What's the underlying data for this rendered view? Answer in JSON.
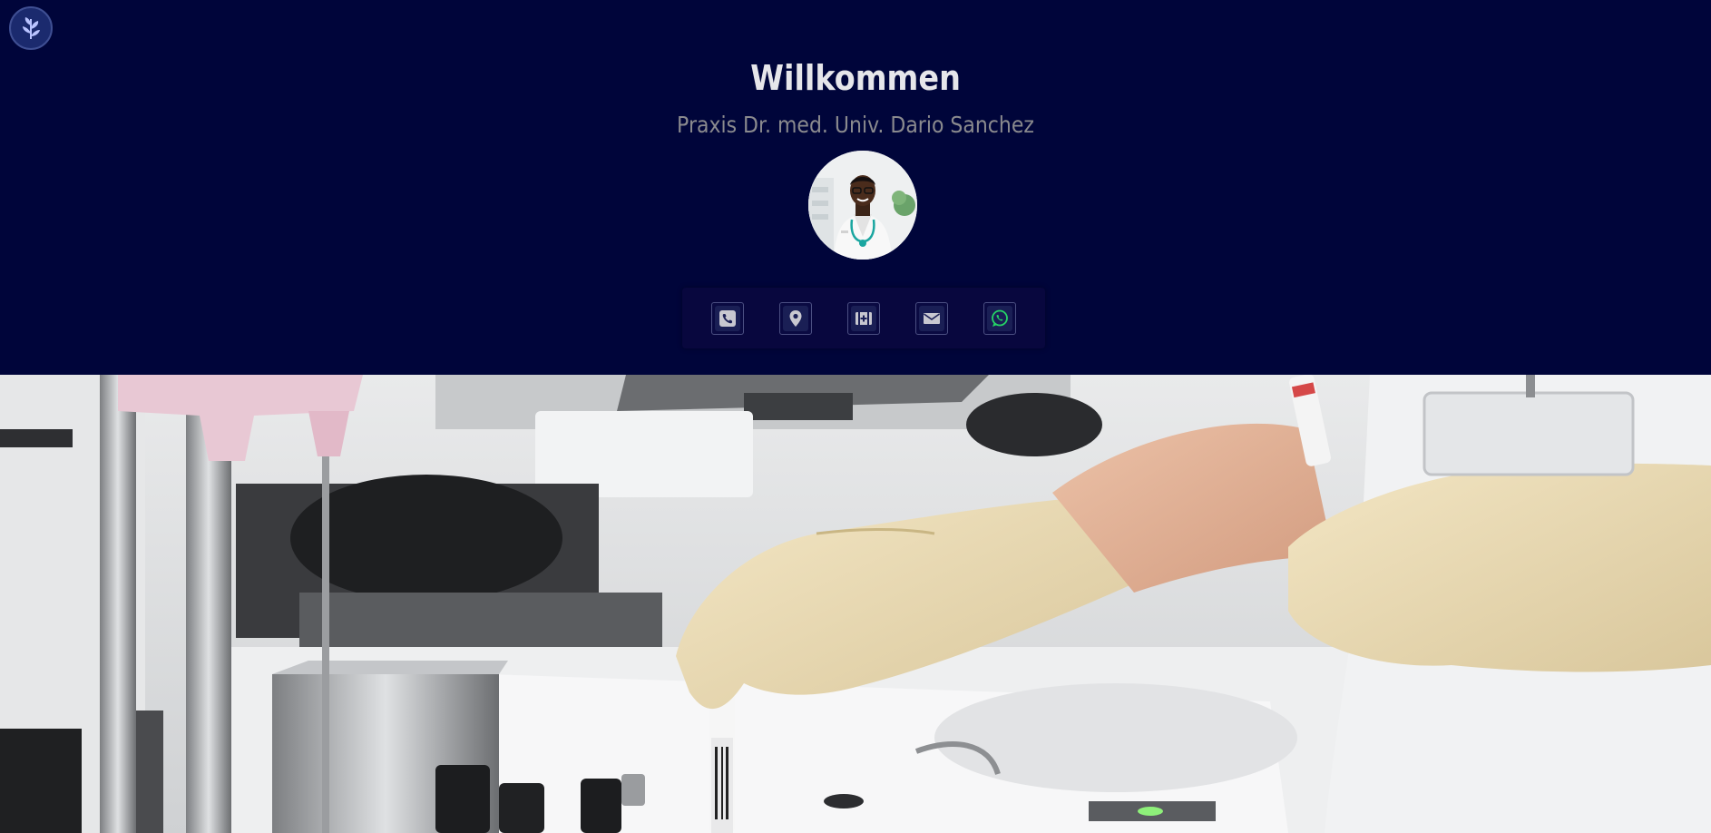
{
  "header": {
    "logo_icon": "leaf-branch-icon",
    "title": "Willkommen",
    "subtitle": "Praxis Dr. med. Univ. Dario Sanchez",
    "avatar_alt": "Portrait of the doctor"
  },
  "social": [
    {
      "name": "phone",
      "icon": "phone-icon"
    },
    {
      "name": "location",
      "icon": "map-pin-icon"
    },
    {
      "name": "doctolib",
      "icon": "medical-kit-icon"
    },
    {
      "name": "email",
      "icon": "envelope-icon"
    },
    {
      "name": "whatsapp",
      "icon": "whatsapp-icon"
    }
  ],
  "hero": {
    "alt": "Laboratory scene: gloved hands handling a blood sample tube"
  },
  "colors": {
    "background": "#00053a",
    "title": "#e6e6ea",
    "subtitle": "#8a8a8e",
    "icon": "#c8c8d0",
    "whatsapp": "#25d366"
  }
}
